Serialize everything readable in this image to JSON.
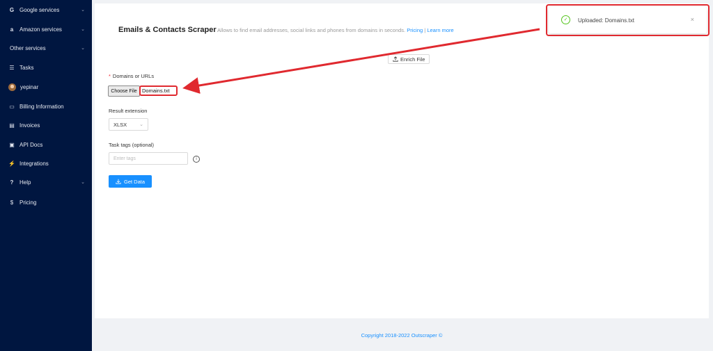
{
  "sidebar": {
    "items": [
      {
        "label": "Google services",
        "icon": "google-icon",
        "glyph": "G",
        "chevron": "⌄"
      },
      {
        "label": "Amazon services",
        "icon": "amazon-icon",
        "glyph": "a",
        "chevron": "⌄"
      },
      {
        "label": "Other services",
        "icon": "",
        "glyph": "",
        "chevron": "⌄"
      },
      {
        "label": "Tasks",
        "icon": "list-icon",
        "glyph": "☰"
      },
      {
        "label": "yepinar",
        "icon": "avatar"
      },
      {
        "label": "Billing Information",
        "icon": "credit-card-icon",
        "glyph": "▭"
      },
      {
        "label": "Invoices",
        "icon": "invoice-icon",
        "glyph": "▤"
      },
      {
        "label": "API Docs",
        "icon": "api-docs-icon",
        "glyph": "▣"
      },
      {
        "label": "Integrations",
        "icon": "plug-icon",
        "glyph": "⚡"
      },
      {
        "label": "Help",
        "icon": "question-icon",
        "glyph": "?",
        "chevron": "⌄"
      },
      {
        "label": "Pricing",
        "icon": "dollar-icon",
        "glyph": "$"
      }
    ]
  },
  "main": {
    "title": "Emails & Contacts Scraper",
    "subtitle": "Allows to find email addresses, social links and phones from domains in seconds.",
    "pricing_link": "Pricing",
    "separator": "|",
    "learn_more_link": "Learn more",
    "enrich_button": "Enrich File",
    "domains_label": "Domains or URLs",
    "required_mark": "*",
    "choose_file_button": "Choose File",
    "file_name": "Domains.txt",
    "result_extension_label": "Result extension",
    "result_extension_value": "XLSX",
    "task_tags_label": "Task tags (optional)",
    "task_tags_placeholder": "Enter tags",
    "get_data_button": "Get Data"
  },
  "footer": {
    "copyright": "Copyright 2018-2022 Outscraper ©"
  },
  "toast": {
    "message": "Uploaded: Domains.txt",
    "close": "×",
    "check": "✓"
  },
  "colors": {
    "sidebar_bg": "#001640",
    "accent": "#1890ff",
    "annotation_red": "#e0292f",
    "success": "#52c41a"
  }
}
